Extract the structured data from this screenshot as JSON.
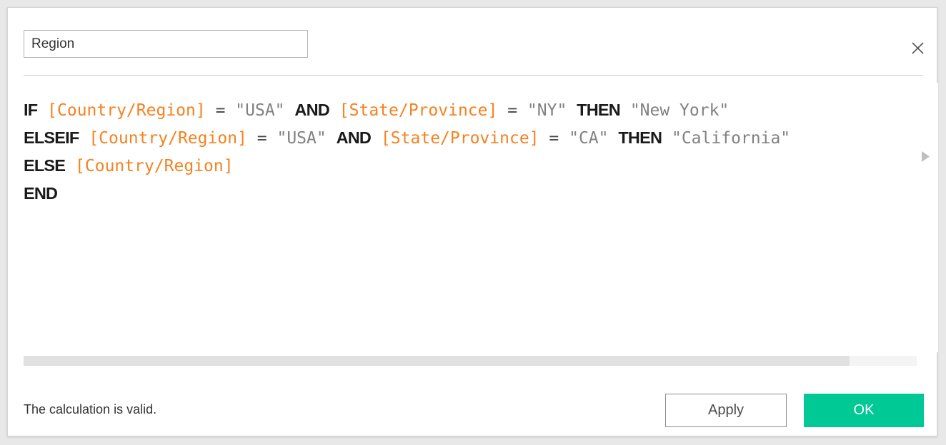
{
  "dialog": {
    "name_field": {
      "value": "Region",
      "placeholder": "Name"
    },
    "close_icon": "close-icon",
    "expand_icon": "triangle-right-icon"
  },
  "formula": {
    "language": "Tableau calculation",
    "plain_text": "IF [Country/Region] = \"USA\" AND [State/Province] = \"NY\" THEN \"New York\"\nELSEIF [Country/Region] = \"USA\" AND [State/Province] = \"CA\" THEN \"California\"\nELSE [Country/Region]\nEND",
    "lines": [
      {
        "index": 1,
        "tokens": [
          {
            "type": "keyword",
            "text": "IF"
          },
          {
            "type": "plain",
            "text": " "
          },
          {
            "type": "field",
            "text": "[Country/Region]"
          },
          {
            "type": "plain",
            "text": " "
          },
          {
            "type": "operator",
            "text": "="
          },
          {
            "type": "plain",
            "text": " "
          },
          {
            "type": "string",
            "text": "\"USA\""
          },
          {
            "type": "plain",
            "text": " "
          },
          {
            "type": "keyword",
            "text": "AND"
          },
          {
            "type": "plain",
            "text": " "
          },
          {
            "type": "field",
            "text": "[State/Province]"
          },
          {
            "type": "plain",
            "text": " "
          },
          {
            "type": "operator",
            "text": "="
          },
          {
            "type": "plain",
            "text": " "
          },
          {
            "type": "string",
            "text": "\"NY\""
          },
          {
            "type": "plain",
            "text": " "
          },
          {
            "type": "keyword",
            "text": "THEN"
          },
          {
            "type": "plain",
            "text": " "
          },
          {
            "type": "string",
            "text": "\"New York\""
          }
        ]
      },
      {
        "index": 2,
        "tokens": [
          {
            "type": "keyword",
            "text": "ELSEIF"
          },
          {
            "type": "plain",
            "text": " "
          },
          {
            "type": "field",
            "text": "[Country/Region]"
          },
          {
            "type": "plain",
            "text": " "
          },
          {
            "type": "operator",
            "text": "="
          },
          {
            "type": "plain",
            "text": " "
          },
          {
            "type": "string",
            "text": "\"USA\""
          },
          {
            "type": "plain",
            "text": " "
          },
          {
            "type": "keyword",
            "text": "AND"
          },
          {
            "type": "plain",
            "text": " "
          },
          {
            "type": "field",
            "text": "[State/Province]"
          },
          {
            "type": "plain",
            "text": " "
          },
          {
            "type": "operator",
            "text": "="
          },
          {
            "type": "plain",
            "text": " "
          },
          {
            "type": "string",
            "text": "\"CA\""
          },
          {
            "type": "plain",
            "text": " "
          },
          {
            "type": "keyword",
            "text": "THEN"
          },
          {
            "type": "plain",
            "text": " "
          },
          {
            "type": "string",
            "text": "\"California\""
          }
        ]
      },
      {
        "index": 3,
        "tokens": [
          {
            "type": "keyword",
            "text": "ELSE"
          },
          {
            "type": "plain",
            "text": " "
          },
          {
            "type": "field",
            "text": "[Country/Region]"
          }
        ]
      },
      {
        "index": 4,
        "tokens": [
          {
            "type": "keyword",
            "text": "END"
          }
        ]
      }
    ]
  },
  "scrollbar": {
    "orientation": "horizontal",
    "thumb_fraction": 0.925
  },
  "footer": {
    "status": "The calculation is valid.",
    "apply_label": "Apply",
    "ok_label": "OK"
  },
  "colors": {
    "field_reference": "#f58220",
    "string_literal": "#818181",
    "keyword": "#1a1a1a",
    "ok_button": "#00c995",
    "dialog_border": "#d4d4d4",
    "page_background": "#e8e8e8",
    "scroll_thumb": "#e1e1e1",
    "scroll_track": "#f4f4f4"
  }
}
